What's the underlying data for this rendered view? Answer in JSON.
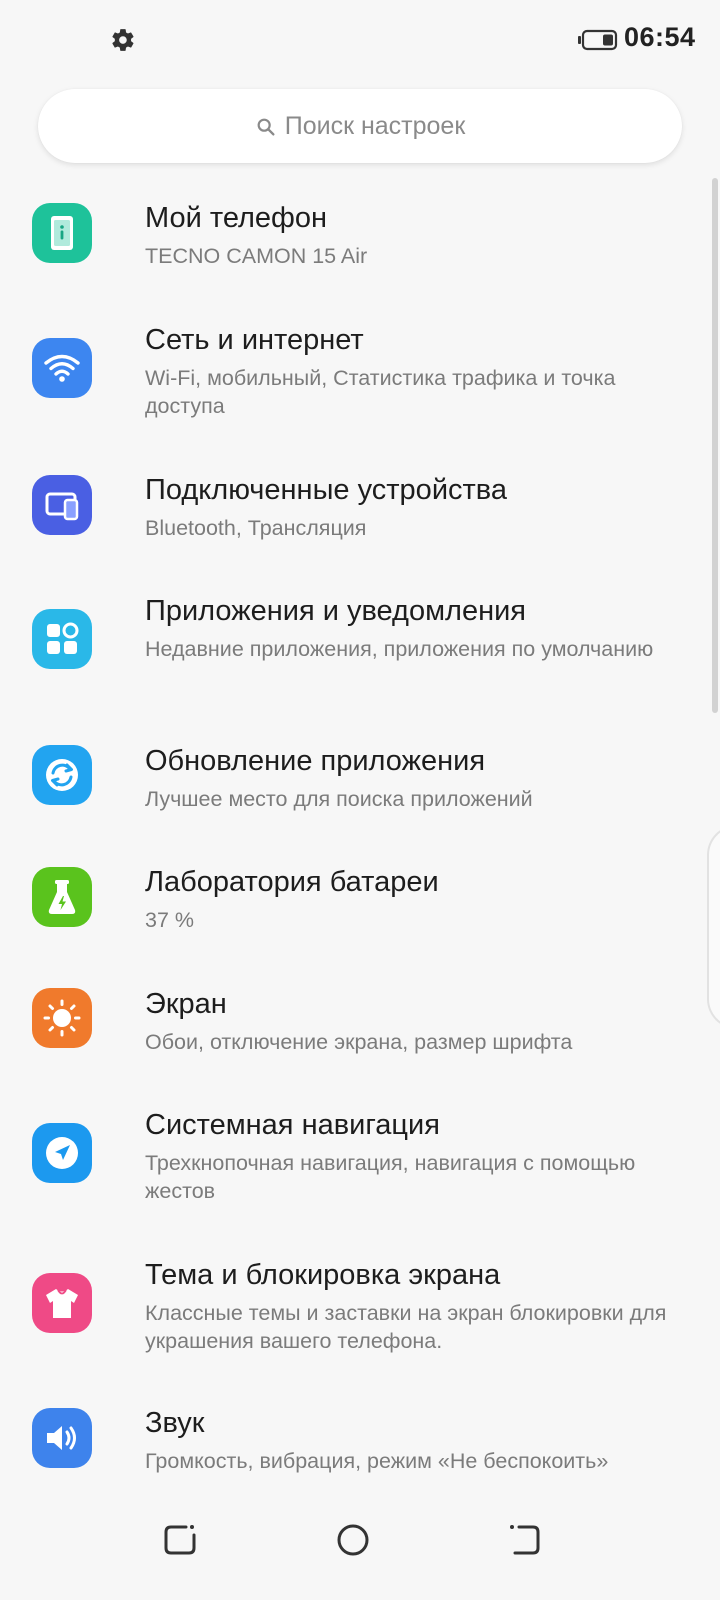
{
  "status_bar": {
    "time": "06:54",
    "icons": [
      "gear-icon",
      "battery-icon"
    ]
  },
  "search": {
    "placeholder": "Поиск настроек"
  },
  "settings": [
    {
      "title": "Мой телефон",
      "subtitle": "TECNO CAMON 15 Air",
      "icon": "phone-icon",
      "color": "#1ec29a"
    },
    {
      "title": "Сеть и интернет",
      "subtitle": "Wi-Fi, мобильный, Статистика трафика и точка доступа",
      "icon": "wifi-icon",
      "color": "#3d86f0"
    },
    {
      "title": "Подключенные устройства",
      "subtitle": "Bluetooth, Трансляция",
      "icon": "devices-icon",
      "color": "#4a5fe3"
    },
    {
      "title": "Приложения и уведомления",
      "subtitle": "Недавние приложения, приложения по умолчанию",
      "icon": "apps-icon",
      "color": "#2ab8e8"
    },
    {
      "title": "Обновление приложения",
      "subtitle": "Лучшее место для поиска приложений",
      "icon": "update-icon",
      "color": "#22a4f0"
    },
    {
      "title": "Лаборатория батареи",
      "subtitle": "37 %",
      "icon": "battery-lab-icon",
      "color": "#5ac31d"
    },
    {
      "title": "Экран",
      "subtitle": "Обои, отключение экрана, размер шрифта",
      "icon": "display-icon",
      "color": "#f07a2c"
    },
    {
      "title": "Системная навигация",
      "subtitle": "Трехкнопочная навигация, навигация с помощью жестов",
      "icon": "navigation-icon",
      "color": "#1c99ef"
    },
    {
      "title": "Тема и блокировка экрана",
      "subtitle": "Классные темы и заставки на экран блокировки для украшения вашего телефона.",
      "icon": "theme-icon",
      "color": "#ef4a86"
    },
    {
      "title": "Звук",
      "subtitle": "Громкость, вибрация, режим «Не беспокоить»",
      "icon": "sound-icon",
      "color": "#3e83ec"
    }
  ],
  "nav_bar": {
    "buttons": [
      "recent-apps-icon",
      "home-icon",
      "back-icon"
    ]
  }
}
